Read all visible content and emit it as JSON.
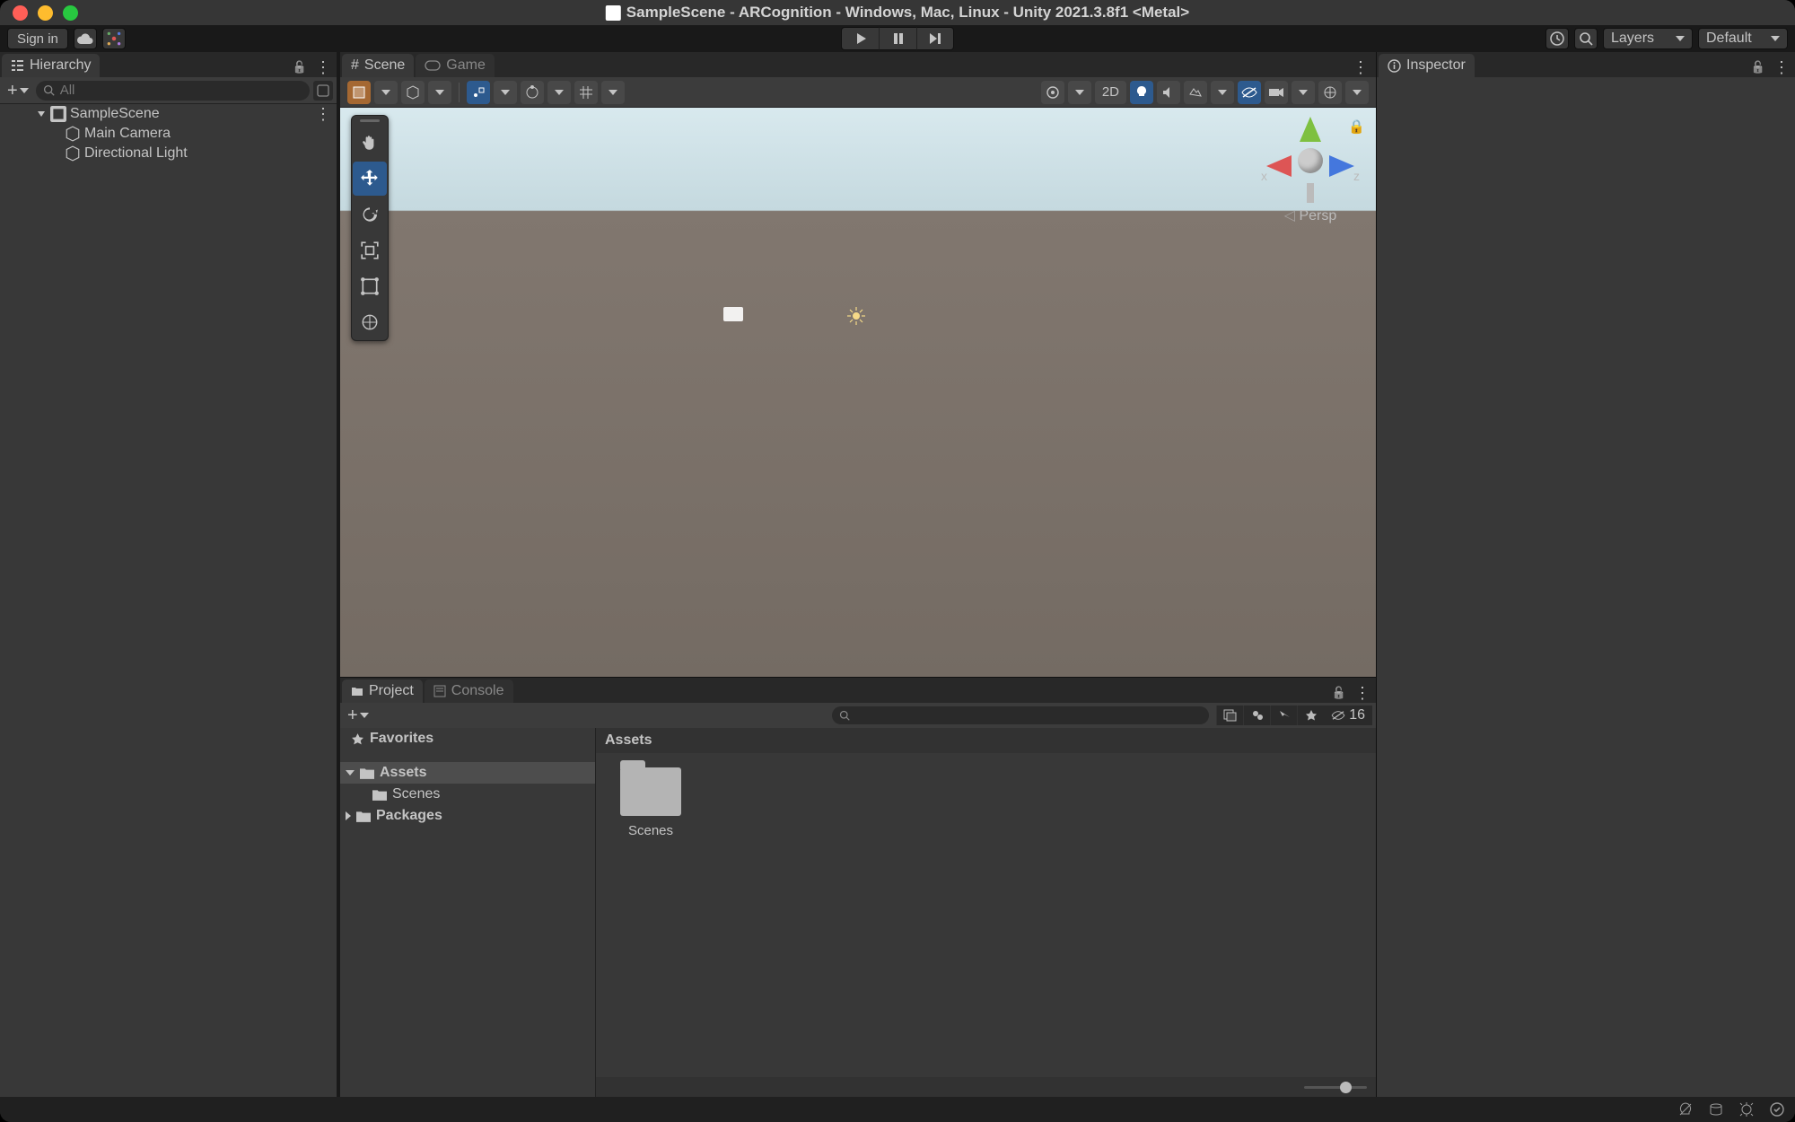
{
  "window_title": "SampleScene - ARCognition - Windows, Mac, Linux - Unity 2021.3.8f1 <Metal>",
  "toolbar": {
    "signin_label": "Sign in",
    "layers_label": "Layers",
    "layout_label": "Default"
  },
  "hierarchy": {
    "tab_label": "Hierarchy",
    "search_placeholder": "All",
    "scene_name": "SampleScene",
    "items": [
      {
        "label": "Main Camera"
      },
      {
        "label": "Directional Light"
      }
    ]
  },
  "scene": {
    "tab_scene": "Scene",
    "tab_game": "Game",
    "mode_2d": "2D",
    "axis_x": "x",
    "axis_z": "z",
    "persp_label": "Persp"
  },
  "inspector": {
    "tab_label": "Inspector"
  },
  "project": {
    "tab_project": "Project",
    "tab_console": "Console",
    "hidden_count": "16",
    "tree": {
      "favorites": "Favorites",
      "assets": "Assets",
      "scenes": "Scenes",
      "packages": "Packages"
    },
    "breadcrumb": "Assets",
    "grid_items": [
      {
        "name": "Scenes"
      }
    ]
  }
}
